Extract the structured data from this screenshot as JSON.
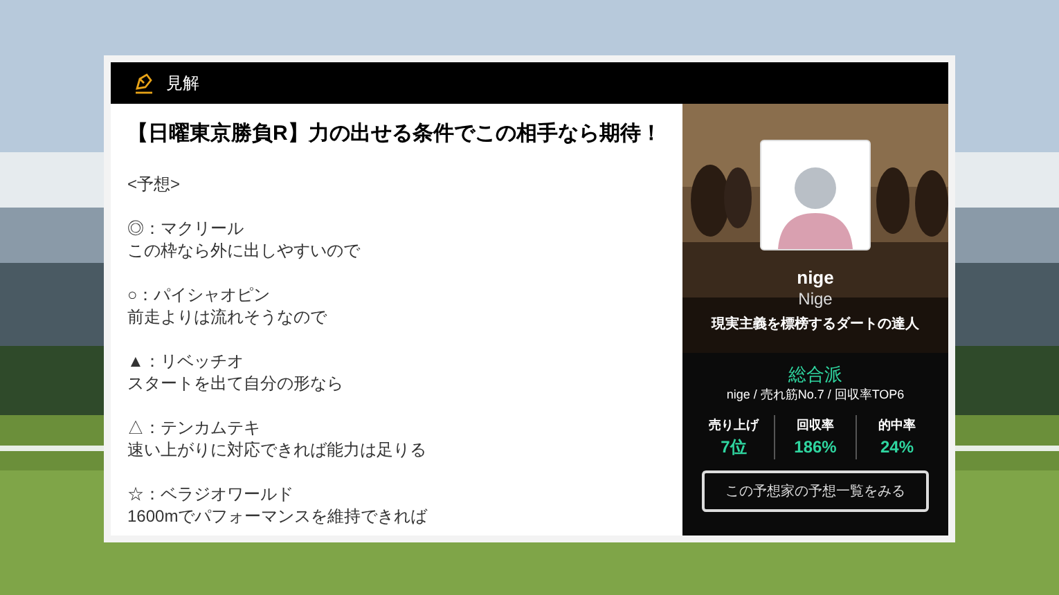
{
  "header": {
    "title": "見解"
  },
  "article": {
    "title": "【日曜東京勝負R】力の出せる条件でこの相手なら期待！",
    "heading": "<予想>",
    "picks": [
      {
        "line": "◎：マクリール",
        "comment": "この枠なら外に出しやすいので"
      },
      {
        "line": "○：パイシャオピン",
        "comment": "前走よりは流れそうなので"
      },
      {
        "line": "▲：リベッチオ",
        "comment": "スタートを出て自分の形なら"
      },
      {
        "line": "△：テンカムテキ",
        "comment": "速い上がりに対応できれば能力は足りる"
      },
      {
        "line": "☆：ベラジオワールド",
        "comment": "1600mでパフォーマンスを維持できれば"
      }
    ]
  },
  "profile": {
    "name": "nige",
    "subname": "Nige",
    "tagline": "現実主義を標榜するダートの達人",
    "style": "総合派",
    "summary": "nige / 売れ筋No.7 / 回収率TOP6",
    "stats": [
      {
        "label": "売り上げ",
        "value": "7位"
      },
      {
        "label": "回収率",
        "value": "186%"
      },
      {
        "label": "的中率",
        "value": "24%"
      }
    ],
    "button": "この予想家の予想一覧をみる"
  }
}
